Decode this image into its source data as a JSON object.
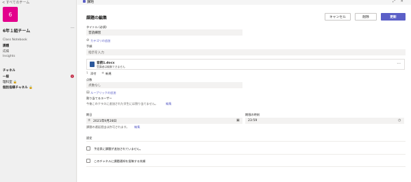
{
  "sidebar": {
    "back_label": "< すべてのチーム",
    "team_tile": "6",
    "team_name": "6年１組チーム",
    "more": "···",
    "nav": [
      "Class Notebook",
      "課題",
      "成績",
      "Insights"
    ],
    "channels_title": "チャネル",
    "channels": [
      {
        "label": "一般",
        "badge": "!"
      },
      {
        "label": "理科室  🔒"
      },
      {
        "label": "個別指導チャネル  🔒"
      }
    ]
  },
  "topbar": {
    "app_title": "課題",
    "icons": "⤢  ✕"
  },
  "form": {
    "heading": "課題の編集",
    "cancel": "キャンセル",
    "discard": "削除",
    "save": "更新",
    "title_label": "タイトル (必須)",
    "title_value": "音読練習",
    "category_link": "カテゴリの追加",
    "instructions_label": "手順",
    "instructions_placeholder": "指示を入力",
    "attachment_name": "音読1.docx",
    "attachment_sub": "受講者は編集できません",
    "attach_link": "添付",
    "new_link": "新規",
    "points_label": "点数",
    "points_value": "点数なし",
    "rubric_link": "ルーブリックの追加",
    "assign_label": "割り当てるユーザー",
    "assign_text": "今後このクラスに追加された学生には割り当てません。",
    "edit_link": "編集",
    "due_date_label": "期日",
    "due_date_value": "2021年9月28日",
    "due_time_label": "期限の時刻",
    "due_time_value": "23:59",
    "late_text": "課題の遅延提出は許可されます。",
    "late_edit": "編集",
    "settings_label": "設定",
    "setting1": "予定表に課題が追加されていません。",
    "setting2": "このチャネルに課題通知を投稿する先順"
  }
}
